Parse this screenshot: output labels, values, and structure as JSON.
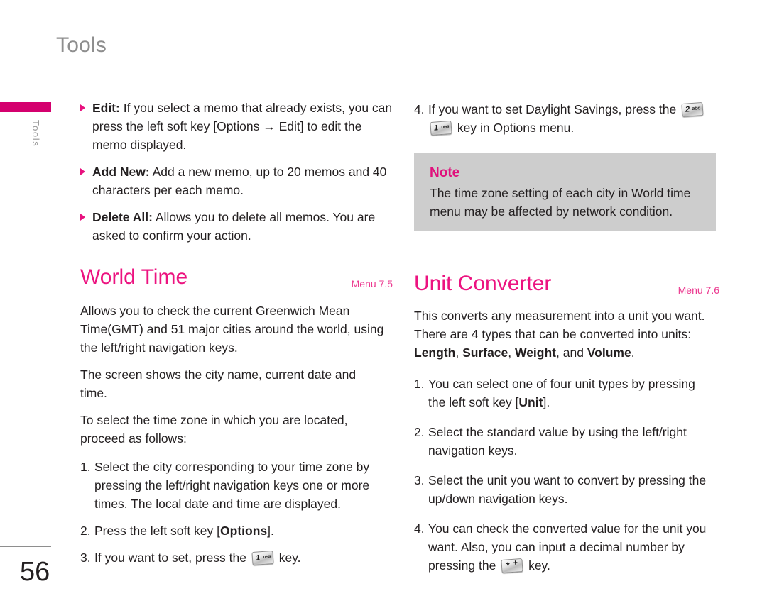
{
  "page": {
    "title": "Tools",
    "side_tab_label": "Tools",
    "number": "56"
  },
  "theme": {
    "accent_pink": "#d4006e",
    "heading_pink": "#ec1380",
    "menu_ref_pink": "#ec3a90",
    "title_gray": "#8e8e8e",
    "note_bg": "#cdcdcd",
    "body_text": "#231f20"
  },
  "left_column": {
    "bullets": [
      {
        "term": "Edit:",
        "text": " If you select a memo that already exists, you can press the left soft key [Options → Edit] to edit the memo displayed."
      },
      {
        "term": "Add New:",
        "text": " Add a new memo, up to 20 memos and 40 characters per each memo."
      },
      {
        "term": "Delete All:",
        "text": " Allows you to delete all memos. You are asked to confirm your action."
      }
    ],
    "section": {
      "title": "World Time",
      "menu_ref": "Menu 7.5"
    },
    "paragraphs": [
      "Allows you to check the current Greenwich Mean Time(GMT) and 51 major cities around the world, using the left/right navigation keys.",
      "The screen shows the city name, current date and time.",
      "To select the time zone in which you are located, proceed as follows:"
    ],
    "steps": [
      {
        "num": "1.",
        "pre": "Select the city corresponding to your time zone by pressing the left/right navigation keys one or more times. The local date and time are displayed.",
        "bold": "",
        "post": ""
      },
      {
        "num": "2.",
        "pre": "Press the left soft key [",
        "bold": "Options",
        "post": "]."
      },
      {
        "num": "3.",
        "pre": "If you want to set, press the ",
        "key": {
          "main": "1",
          "sub": "œø"
        },
        "post": " key."
      }
    ]
  },
  "right_column": {
    "top_step": {
      "num": "4.",
      "pre": "If you want to set Daylight Savings, press the ",
      "key1": {
        "main": "2",
        "sub": "abc"
      },
      "mid": " ",
      "key2": {
        "main": "1",
        "sub": "œø"
      },
      "post": " key in Options menu."
    },
    "note": {
      "title": "Note",
      "body": "The time zone setting of each city in World time menu may be affected by network condition."
    },
    "section": {
      "title": "Unit Converter",
      "menu_ref": "Menu 7.6"
    },
    "intro": {
      "line1": "This converts any measurement into a unit you want. There are 4 types that can be converted into units: ",
      "bold_terms": [
        "Length",
        "Surface",
        "Weight",
        "Volume"
      ],
      "joiner1": ", ",
      "joiner2": ", ",
      "joiner3": ", and ",
      "period": "."
    },
    "steps": [
      {
        "num": "1.",
        "pre": "You can select one of four unit types by pressing the left soft key [",
        "bold": "Unit",
        "post": "]."
      },
      {
        "num": "2.",
        "pre": "Select the standard value by using the left/right navigation keys.",
        "bold": "",
        "post": ""
      },
      {
        "num": "3.",
        "pre": "Select the unit you want to convert by pressing the up/down navigation keys.",
        "bold": "",
        "post": ""
      },
      {
        "num": "4.",
        "pre": "You can check the converted value for the unit you want. Also, you can input a decimal number by pressing the ",
        "key": {
          "main": "*",
          "sub": "+"
        },
        "post": " key."
      }
    ]
  }
}
